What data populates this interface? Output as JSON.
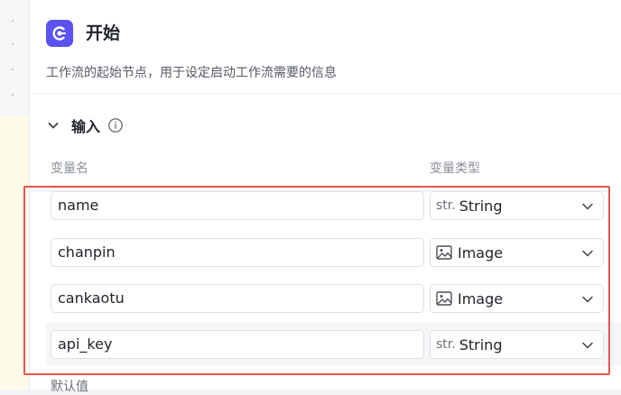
{
  "node": {
    "title": "开始",
    "description": "工作流的起始节点，用于设定启动工作流需要的信息",
    "icon": "start-node-icon"
  },
  "input_section": {
    "label": "输入",
    "expanded": true,
    "col_name_header": "变量名",
    "col_type_header": "变量类型",
    "rows": [
      {
        "name": "name",
        "type_prefix": "str.",
        "type": "String",
        "type_icon": "string-type-icon"
      },
      {
        "name": "chanpin",
        "type_prefix": "",
        "type": "Image",
        "type_icon": "image-type-icon"
      },
      {
        "name": "cankaotu",
        "type_prefix": "",
        "type": "Image",
        "type_icon": "image-type-icon"
      },
      {
        "name": "api_key",
        "type_prefix": "str.",
        "type": "String",
        "type_icon": "string-type-icon"
      }
    ],
    "default_label": "默认值"
  },
  "colors": {
    "accent": "#5b52f0",
    "highlight_border": "#e4564d"
  }
}
